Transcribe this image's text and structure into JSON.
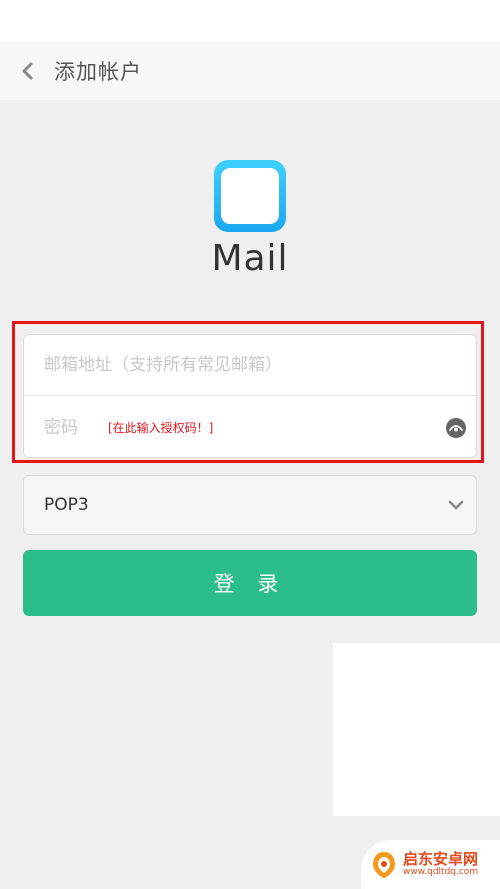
{
  "header": {
    "title": "添加帐户",
    "back_icon": "chevron-left-icon"
  },
  "app": {
    "name": "Mail",
    "icon": "mail-app-icon",
    "accent_color": "#1aa7f0"
  },
  "form": {
    "email_placeholder": "邮箱地址（支持所有常见邮箱）",
    "email_value": "",
    "password_placeholder": "密码",
    "password_value": "",
    "password_hint": "[在此输入授权码！]",
    "toggle_icon": "eye-toggle-icon",
    "highlight_color": "#e4161d"
  },
  "protocol": {
    "selected": "POP3",
    "chevron_icon": "chevron-down-icon"
  },
  "login": {
    "label": "登 录",
    "color": "#2bbd8a"
  },
  "watermark": {
    "title": "启东安卓网",
    "url": "www.qdltdq.com"
  }
}
